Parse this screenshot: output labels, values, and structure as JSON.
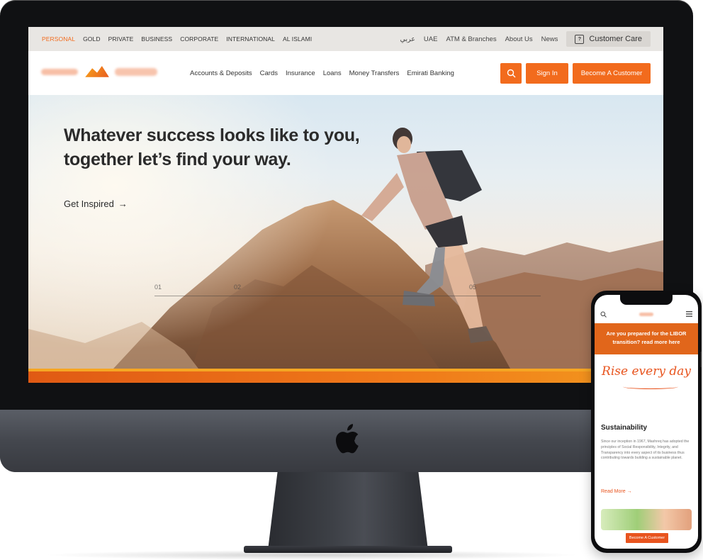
{
  "website": {
    "segments": [
      {
        "label": "PERSONAL",
        "active": true
      },
      {
        "label": "GOLD"
      },
      {
        "label": "PRIVATE"
      },
      {
        "label": "BUSINESS"
      },
      {
        "label": "CORPORATE"
      },
      {
        "label": "INTERNATIONAL"
      },
      {
        "label": "AL ISLAMI"
      }
    ],
    "top_links": {
      "arabic": "عربي",
      "country": "UAE",
      "atm": "ATM & Branches",
      "about": "About Us",
      "news": "News",
      "customer_care": "Customer Care"
    },
    "nav": [
      "Accounts & Deposits",
      "Cards",
      "Insurance",
      "Loans",
      "Money Transfers",
      "Emirati Banking"
    ],
    "buttons": {
      "sign_in": "Sign In",
      "become_customer": "Become A Customer"
    },
    "hero": {
      "headline": "Whatever success looks like to you, together let’s find your way.",
      "cta": "Get Inspired",
      "cta_arrow": "→",
      "slide_numbers": [
        "01",
        "02",
        "05"
      ]
    }
  },
  "phone": {
    "banner": "Are you prepared for the LIBOR transition? read more here",
    "tagline": "Rise every day",
    "section_title": "Sustainability",
    "section_body": "Since our inception in 1967, Mashreq has adopted the principles of Social Responsibility, Integrity, and Transparency into every aspect of its business thus contributing towards building a sustainable planet.",
    "read_more": "Read More →",
    "cta": "Become A Customer"
  },
  "colors": {
    "brand_orange": "#f26b1d",
    "active_segment": "#f26b1d",
    "footer_band": "#e05a14"
  },
  "icons": [
    "search-icon",
    "customer-care-icon",
    "menu-icon",
    "apple-logo-icon"
  ]
}
